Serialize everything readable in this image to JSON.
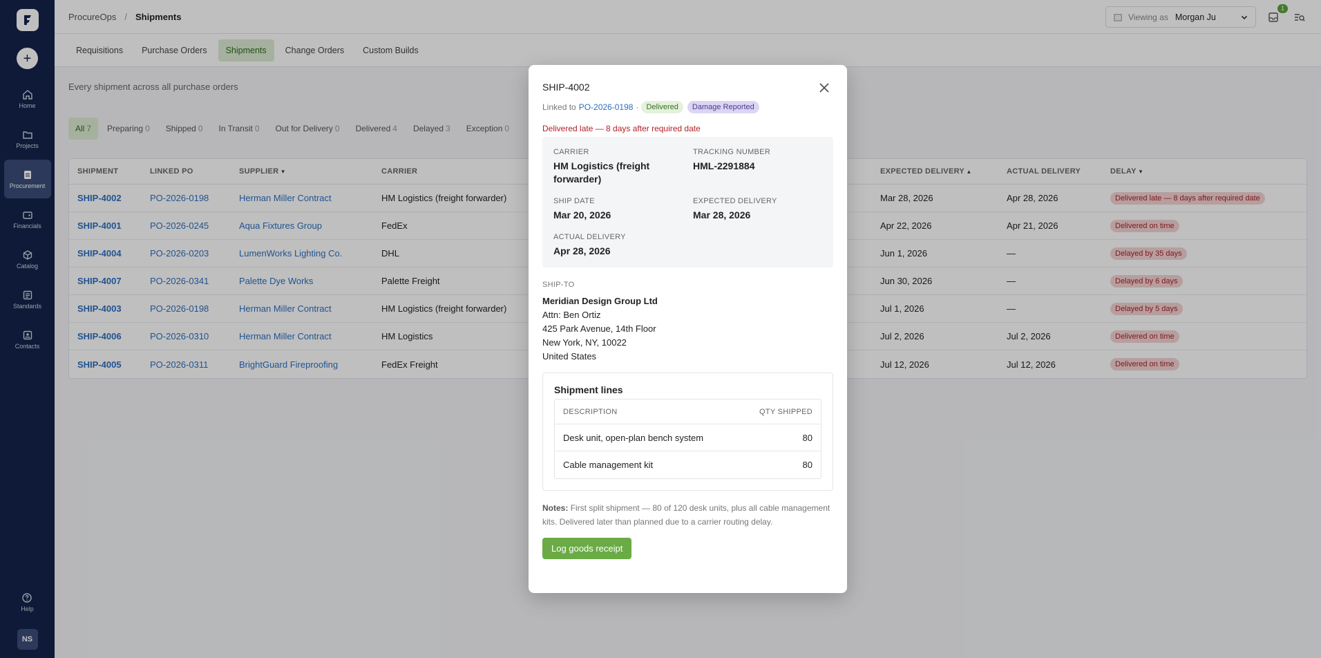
{
  "app": {
    "avatar_initials": "NS"
  },
  "sidebar": {
    "items": [
      {
        "label": "Home",
        "icon": "home-icon",
        "active": false
      },
      {
        "label": "Projects",
        "icon": "folder-icon",
        "active": false
      },
      {
        "label": "Procurement",
        "icon": "clipboard-icon",
        "active": true
      },
      {
        "label": "Financials",
        "icon": "wallet-icon",
        "active": false
      },
      {
        "label": "Catalog",
        "icon": "cube-icon",
        "active": false
      },
      {
        "label": "Standards",
        "icon": "list-icon",
        "active": false
      },
      {
        "label": "Contacts",
        "icon": "contact-icon",
        "active": false
      }
    ],
    "help_label": "Help"
  },
  "header": {
    "breadcrumb_root": "ProcureOps",
    "breadcrumb_current": "Shipments",
    "viewing_as_label": "Viewing as",
    "viewing_as_name": "Morgan Ju",
    "notification_count": "1"
  },
  "tabs": [
    "Requisitions",
    "Purchase Orders",
    "Shipments",
    "Change Orders",
    "Custom Builds"
  ],
  "active_tab": "Shipments",
  "page_subtitle": "Every shipment across all purchase orders",
  "filters": [
    {
      "label": "All",
      "count": "7",
      "active": true
    },
    {
      "label": "Preparing",
      "count": "0"
    },
    {
      "label": "Shipped",
      "count": "0"
    },
    {
      "label": "In Transit",
      "count": "0"
    },
    {
      "label": "Out for Delivery",
      "count": "0"
    },
    {
      "label": "Delivered",
      "count": "4"
    },
    {
      "label": "Delayed",
      "count": "3"
    },
    {
      "label": "Exception",
      "count": "0"
    }
  ],
  "table": {
    "columns": {
      "shipment": "SHIPMENT",
      "linked_po": "LINKED PO",
      "supplier": "SUPPLIER",
      "carrier": "CARRIER",
      "expected": "EXPECTED DELIVERY",
      "actual": "ACTUAL DELIVERY",
      "delay": "DELAY"
    },
    "rows": [
      {
        "shipment": "SHIP-4002",
        "po": "PO-2026-0198",
        "supplier": "Herman Miller Contract",
        "carrier": "HM Logistics (freight forwarder)",
        "expected": "Mar 28, 2026",
        "actual": "Apr 28, 2026",
        "delay": "Delivered late — 8 days after required date"
      },
      {
        "shipment": "SHIP-4001",
        "po": "PO-2026-0245",
        "supplier": "Aqua Fixtures Group",
        "carrier": "FedEx",
        "expected": "Apr 22, 2026",
        "actual": "Apr 21, 2026",
        "delay": "Delivered on time"
      },
      {
        "shipment": "SHIP-4004",
        "po": "PO-2026-0203",
        "supplier": "LumenWorks Lighting Co.",
        "carrier": "DHL",
        "expected": "Jun 1, 2026",
        "actual": "—",
        "delay": "Delayed by 35 days"
      },
      {
        "shipment": "SHIP-4007",
        "po": "PO-2026-0341",
        "supplier": "Palette Dye Works",
        "carrier": "Palette Freight",
        "expected": "Jun 30, 2026",
        "actual": "—",
        "delay": "Delayed by 6 days"
      },
      {
        "shipment": "SHIP-4003",
        "po": "PO-2026-0198",
        "supplier": "Herman Miller Contract",
        "carrier": "HM Logistics (freight forwarder)",
        "expected": "Jul 1, 2026",
        "actual": "—",
        "delay": "Delayed by 5 days"
      },
      {
        "shipment": "SHIP-4006",
        "po": "PO-2026-0310",
        "supplier": "Herman Miller Contract",
        "carrier": "HM Logistics",
        "expected": "Jul 2, 2026",
        "actual": "Jul 2, 2026",
        "delay": "Delivered on time"
      },
      {
        "shipment": "SHIP-4005",
        "po": "PO-2026-0311",
        "supplier": "BrightGuard Fireproofing",
        "carrier": "FedEx Freight",
        "expected": "Jul 12, 2026",
        "actual": "Jul 12, 2026",
        "delay": "Delivered on time"
      }
    ]
  },
  "modal": {
    "title": "SHIP-4002",
    "linked_to_label": "Linked to",
    "linked_po": "PO-2026-0198",
    "separator": "·",
    "status_badge": "Delivered",
    "flag_badge": "Damage Reported",
    "late_message": "Delivered late — 8 days after required date",
    "carrier_label": "CARRIER",
    "carrier": "HM Logistics (freight forwarder)",
    "tracking_label": "TRACKING NUMBER",
    "tracking": "HML-2291884",
    "ship_date_label": "SHIP DATE",
    "ship_date": "Mar 20, 2026",
    "expected_label": "EXPECTED DELIVERY",
    "expected": "Mar 28, 2026",
    "actual_label": "ACTUAL DELIVERY",
    "actual": "Apr 28, 2026",
    "ship_to_label": "SHIP-TO",
    "ship_to": {
      "company": "Meridian Design Group Ltd",
      "attn": "Attn: Ben Ortiz",
      "street": "425 Park Avenue, 14th Floor",
      "city": "New York, NY, 10022",
      "country": "United States"
    },
    "lines_title": "Shipment lines",
    "lines_col_desc": "DESCRIPTION",
    "lines_col_qty": "QTY SHIPPED",
    "lines": [
      {
        "description": "Desk unit, open-plan bench system",
        "qty": "80"
      },
      {
        "description": "Cable management kit",
        "qty": "80"
      }
    ],
    "notes_label": "Notes:",
    "notes": "First split shipment — 80 of 120 desk units, plus all cable management kits. Delivered later than planned due to a carrier routing delay.",
    "action_button": "Log goods receipt"
  }
}
